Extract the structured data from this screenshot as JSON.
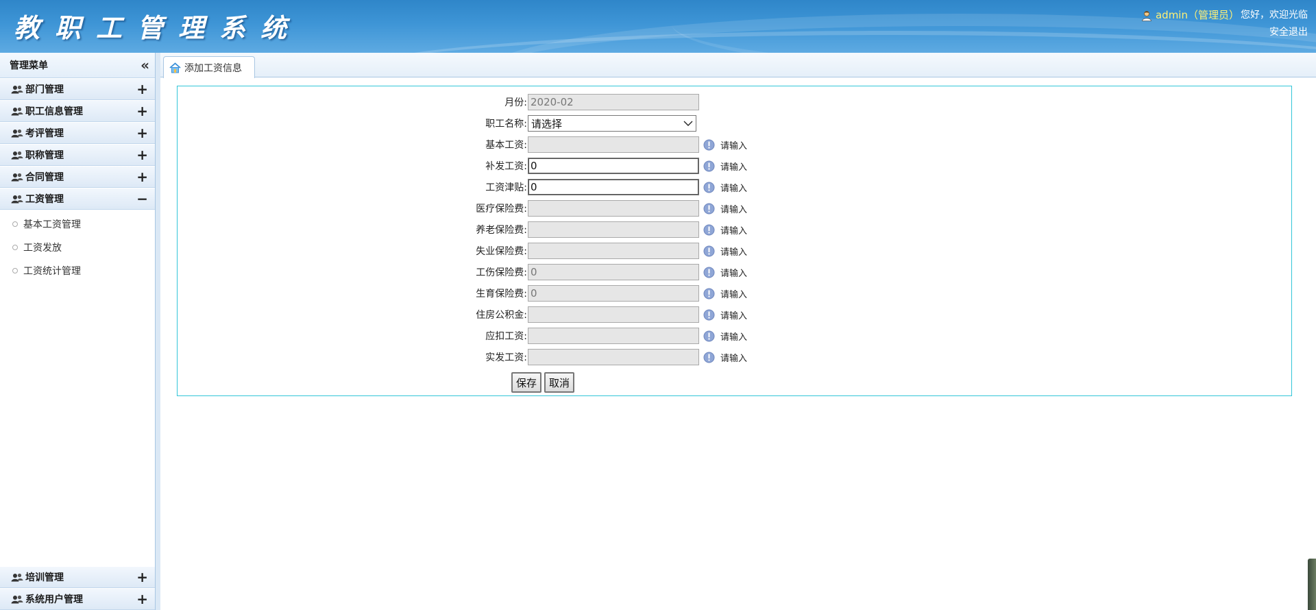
{
  "header": {
    "system_title": "教职工管理系统",
    "user_name": "admin（管理员）",
    "greeting": "您好，欢迎光临",
    "logout": "安全退出"
  },
  "sidebar": {
    "title": "管理菜单",
    "collapse_icon": "double-chevron-left-icon",
    "groups": [
      {
        "label": "部门管理",
        "expanded": false
      },
      {
        "label": "职工信息管理",
        "expanded": false
      },
      {
        "label": "考评管理",
        "expanded": false
      },
      {
        "label": "职称管理",
        "expanded": false
      },
      {
        "label": "合同管理",
        "expanded": false
      },
      {
        "label": "工资管理",
        "expanded": true
      }
    ],
    "submenu": [
      "基本工资管理",
      "工资发放",
      "工资统计管理"
    ],
    "bottom_groups": [
      {
        "label": "培训管理",
        "expanded": false
      },
      {
        "label": "系统用户管理",
        "expanded": false
      }
    ],
    "plus": "+",
    "minus": "−"
  },
  "tabs": [
    {
      "label": "添加工资信息"
    }
  ],
  "form": {
    "month": {
      "label": "月份:",
      "value": "2020-02"
    },
    "employee": {
      "label": "职工名称:",
      "selected": "请选择"
    },
    "hint_text": "请输入",
    "fields": [
      {
        "label": "基本工资:",
        "value": ""
      },
      {
        "label": "补发工资:",
        "value": "0"
      },
      {
        "label": "工资津贴:",
        "value": "0"
      },
      {
        "label": "医疗保险费:",
        "value": ""
      },
      {
        "label": "养老保险费:",
        "value": ""
      },
      {
        "label": "失业保险费:",
        "value": ""
      },
      {
        "label": "工伤保险费:",
        "value": "0"
      },
      {
        "label": "生育保险费:",
        "value": "0"
      },
      {
        "label": "住房公积金:",
        "value": ""
      },
      {
        "label": "应扣工资:",
        "value": ""
      },
      {
        "label": "实发工资:",
        "value": ""
      }
    ],
    "save_label": "保存",
    "cancel_label": "取消"
  },
  "colors": {
    "header_blue": "#3e95d6",
    "panel_border": "#31c5d8",
    "username_yellow": "#fff176"
  }
}
